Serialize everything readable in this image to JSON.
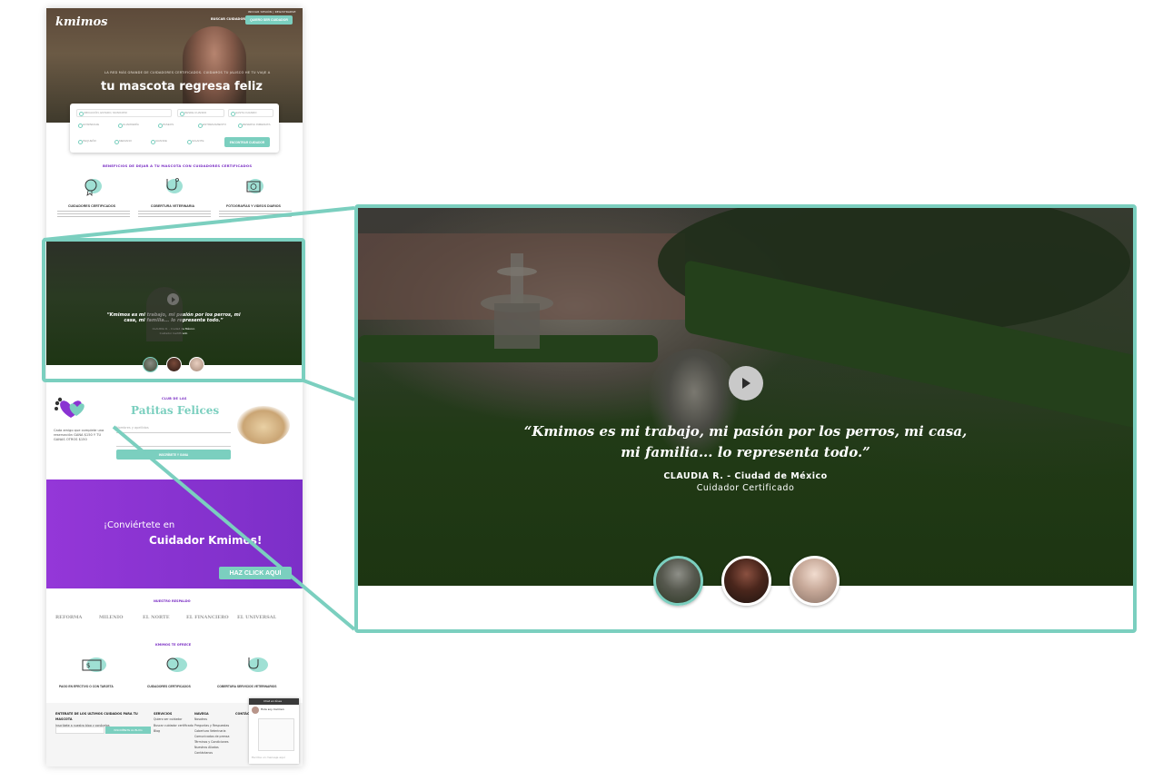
{
  "colors": {
    "accent": "#7bcfbf",
    "purple": "#8a33d2",
    "white": "#ffffff"
  },
  "page": {
    "header": {
      "logo": "kmimos",
      "top_links": "INICIAR SESIÓN | REGISTRARSE",
      "search_link": "BUSCAR CUIDADOR",
      "cta_button": "QUIERO SER CUIDADOR"
    },
    "hero": {
      "small_text": "LA RED MÁS GRANDE DE CUIDADORES CERTIFICADOS. CUIDAMOS TU JALISCO HE TU VIAJE A",
      "headline": "tu mascota regresa feliz"
    },
    "search_form": {
      "location_placeholder": "UBICACIÓN, ESTADO, MUNICIPIO",
      "from_label": "DESDE CUANDO",
      "to_label": "HASTA CUANDO",
      "services": [
        "HOSPEDAJE",
        "GUARDERÍA",
        "PASEOS",
        "ENTRENAMIENTO",
        "RESERVA INMEDIATA"
      ],
      "sizes": [
        "PEQUEÑO",
        "MEDIANO",
        "GRANDE",
        "GIGANTE"
      ],
      "submit": "ENCONTRAR CUIDADOR"
    },
    "benefits": {
      "title": "BENEFICIOS DE DEJAR A TU MASCOTA CON CUIDADORES CERTIFICADOS",
      "items": [
        "CUIDADORES CERTIFICADOS",
        "COBERTURA VETERINARIA",
        "FOTOGRAFÍAS Y VIDEOS DIARIOS"
      ]
    },
    "mini_testimonial": {
      "quote": "“Kmimos es mi trabajo, mi pasión por los perros, mi casa, mi familia... lo representa todo.”",
      "author": "CLAUDIA R. - Ciudad de México",
      "role": "Cuidador Certificado"
    },
    "club": {
      "small_title": "CLUB DE LAS",
      "title": "Patitas Felices",
      "text": "Cada amigo que complete una reservación GANA $150 Y TÚ GANAS OTROS $150",
      "name_placeholder": "Nombres y apellidos",
      "button": "INSCRÍBETE Y GANA"
    },
    "become_caregiver": {
      "line1": "¡Conviértete en",
      "line2": "Cuidador Kmimos!",
      "button": "HAZ CLICK AQUÍ"
    },
    "backing": {
      "title": "NUESTRO RESPALDO",
      "press": [
        "REFORMA",
        "MILENIO",
        "EL NORTE",
        "EL FINANCIERO",
        "EL UNIVERSAL"
      ]
    },
    "offers": {
      "title": "KMIMOS TE OFRECE",
      "items": [
        "PAGO EN EFECTIVO O CON TARJETA",
        "CUIDADORES CERTIFICADOS",
        "COBERTURA SERVICIOS VETERINARIOS"
      ]
    },
    "footer": {
      "newsletter_title": "ENTERATE DE LOS ULTIMOS CUIDADOS PARA TU MASCOTA",
      "newsletter_text": "Inscribete a nuestro blog y conócelas",
      "newsletter_placeholder": "Introduce tu correo",
      "newsletter_button": "INSCRÍBETE AL BLOG",
      "services_title": "SERVICIOS",
      "services": [
        "Quiero ser cuidador",
        "Buscar cuidador certificado",
        "Blog"
      ],
      "nav_title": "NAVEGA",
      "nav": [
        "Nosotros",
        "Preguntas y Respuestas",
        "Cobertura Veterinaria",
        "Comunicados de prensa",
        "Términos y Condiciones",
        "Nuestros Aliados",
        "Contáctanos"
      ],
      "contact_title": "CONTÁCTANOS"
    },
    "chat": {
      "header": "Chat en línea",
      "agent": "Hola soy Carmen",
      "input_placeholder": "Escribe un mensaje aquí"
    }
  },
  "zoom": {
    "quote": "“Kmimos es mi trabajo, mi pasión por los perros, mi casa, mi familia... lo representa todo.”",
    "author": "CLAUDIA R. - Ciudad de México",
    "role": "Cuidador Certificado",
    "avatars": [
      {
        "name": "testimonial-avatar-1",
        "active": true
      },
      {
        "name": "testimonial-avatar-2",
        "active": false
      },
      {
        "name": "testimonial-avatar-3",
        "active": false
      }
    ]
  }
}
